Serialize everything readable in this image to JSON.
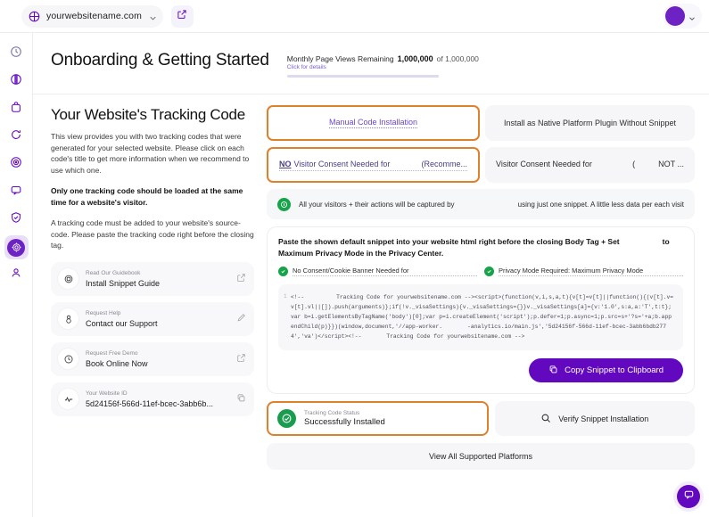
{
  "topbar": {
    "site_name": "yourwebsitename.com",
    "globe_icon": "globe-icon",
    "chevron_icon": "chevron-down-icon",
    "external_link_icon": "external-link-icon",
    "avatar_icon": "avatar",
    "avatar_chevron_icon": "chevron-down-icon"
  },
  "sidebar": {
    "items": [
      {
        "name": "sidebar-item-overview",
        "icon": "clock-icon",
        "active": false
      },
      {
        "name": "sidebar-item-analytics",
        "icon": "pie-chart-icon",
        "active": false
      },
      {
        "name": "sidebar-item-ecommerce",
        "icon": "bag-icon",
        "active": false
      },
      {
        "name": "sidebar-item-sessions",
        "icon": "replay-icon",
        "active": false
      },
      {
        "name": "sidebar-item-targets",
        "icon": "target-icon",
        "active": false
      },
      {
        "name": "sidebar-item-messages",
        "icon": "chat-icon",
        "active": false
      },
      {
        "name": "sidebar-item-privacy",
        "icon": "shield-icon",
        "active": false
      },
      {
        "name": "sidebar-item-settings",
        "icon": "gear-icon",
        "active": true
      },
      {
        "name": "sidebar-item-account",
        "icon": "person-icon",
        "active": false
      }
    ]
  },
  "header": {
    "title": "Onboarding & Getting Started",
    "quota_label": "Monthly Page Views Remaining",
    "quota_value": "1,000,000",
    "quota_of": "of 1,000,000",
    "quota_sub": "Click for details"
  },
  "left": {
    "title": "Your Website's Tracking Code",
    "paragraph": "This view provides you with two tracking codes that were generated for your selected website. Please click on each code's title to get more information when we recommend to use which one.",
    "bold_note": "Only one tracking code should be loaded at the same time for a website's visitor.",
    "paragraph2": "A tracking code must be added to your website's source-code. Please paste the tracking code right before the closing tag.",
    "cards": [
      {
        "sub": "Read Our Guidebook",
        "main": "Install Snippet Guide",
        "icon": "book-icon",
        "action_icon": "external-link-icon"
      },
      {
        "sub": "Request Help",
        "main": "Contact our Support",
        "icon": "person-icon",
        "action_icon": "edit-icon"
      },
      {
        "sub": "Request Free Demo",
        "main": "Book Online Now",
        "icon": "clock-icon",
        "action_icon": "external-link-icon"
      },
      {
        "sub": "Your Website ID",
        "main": "5d24156f-566d-11ef-bcec-3abb6b...",
        "icon": "pulse-icon",
        "action_icon": "copy-icon"
      }
    ]
  },
  "right": {
    "tabs_row1": [
      {
        "label": "Manual Code Installation",
        "selected": true
      },
      {
        "label": "Install as Native Platform Plugin Without Snippet",
        "selected": false
      }
    ],
    "tabs_row2": [
      {
        "prefix": "NO",
        "label": "Visitor Consent Needed for",
        "suffix": "(Recomme...",
        "selected": true
      },
      {
        "prefix": "",
        "label": "Visitor Consent Needed for",
        "suffix": "(",
        "suffix2": "NOT ...",
        "selected": false
      }
    ],
    "note": {
      "icon": "info-icon",
      "text_left": "All your visitors + their actions will be captured by",
      "text_right": "using just one snippet. A little less data per each visit"
    },
    "snippet": {
      "heading_line1_a": "Paste the shown default snippet into your website html right before the closing Body Tag + Set",
      "heading_line1_b": "to",
      "heading_line2": "Maximum Privacy Mode in the Privacy Center.",
      "pills": [
        {
          "label": "No Consent/Cookie Banner Needed for",
          "icon": "check-circle-icon"
        },
        {
          "label": "Privacy Mode Required: Maximum Privacy Mode",
          "icon": "check-circle-icon"
        }
      ],
      "gutter": "1",
      "code_part1": "<!--",
      "code_part2": "Tracking Code for yourwebsitename.com --><script>(function(v,i,s,a,t){v[t]=v[t]||function(){(v[t].v=v[t].vl||[]).push(arguments)};if(!v._visaSettings){v._visaSettings={}}v._visaSettings[a]={v:'1.0',s:a,a:'T',t:t};var b=i.getElementsByTagName('body')[0];var p=i.createElement('script');p.defer=1;p.async=1;p.src=s+'?s='+a;b.appendChild(p)}})(window,document,'//app-worker.",
      "code_part3": "-analytics.io/main.js','5d24156f-566d-11ef-bcec-3abb6bdb2774','va')</script><!--",
      "code_part4": "Tracking Code for yourwebsitename.com -->",
      "copy_label": "Copy Snippet to Clipboard",
      "copy_icon": "copy-icon"
    },
    "status": {
      "sub": "Tracking Code Status",
      "main": "Successfully Installed",
      "icon": "check-circle-icon"
    },
    "verify": {
      "label": "Verify Snippet Installation",
      "icon": "search-icon"
    },
    "platforms": {
      "label": "View All Supported Platforms"
    }
  },
  "fab": {
    "icon": "chat-icon"
  },
  "colors": {
    "brand_purple": "#6208bf",
    "highlight_orange": "#df812c",
    "success_green": "#17a34a"
  }
}
